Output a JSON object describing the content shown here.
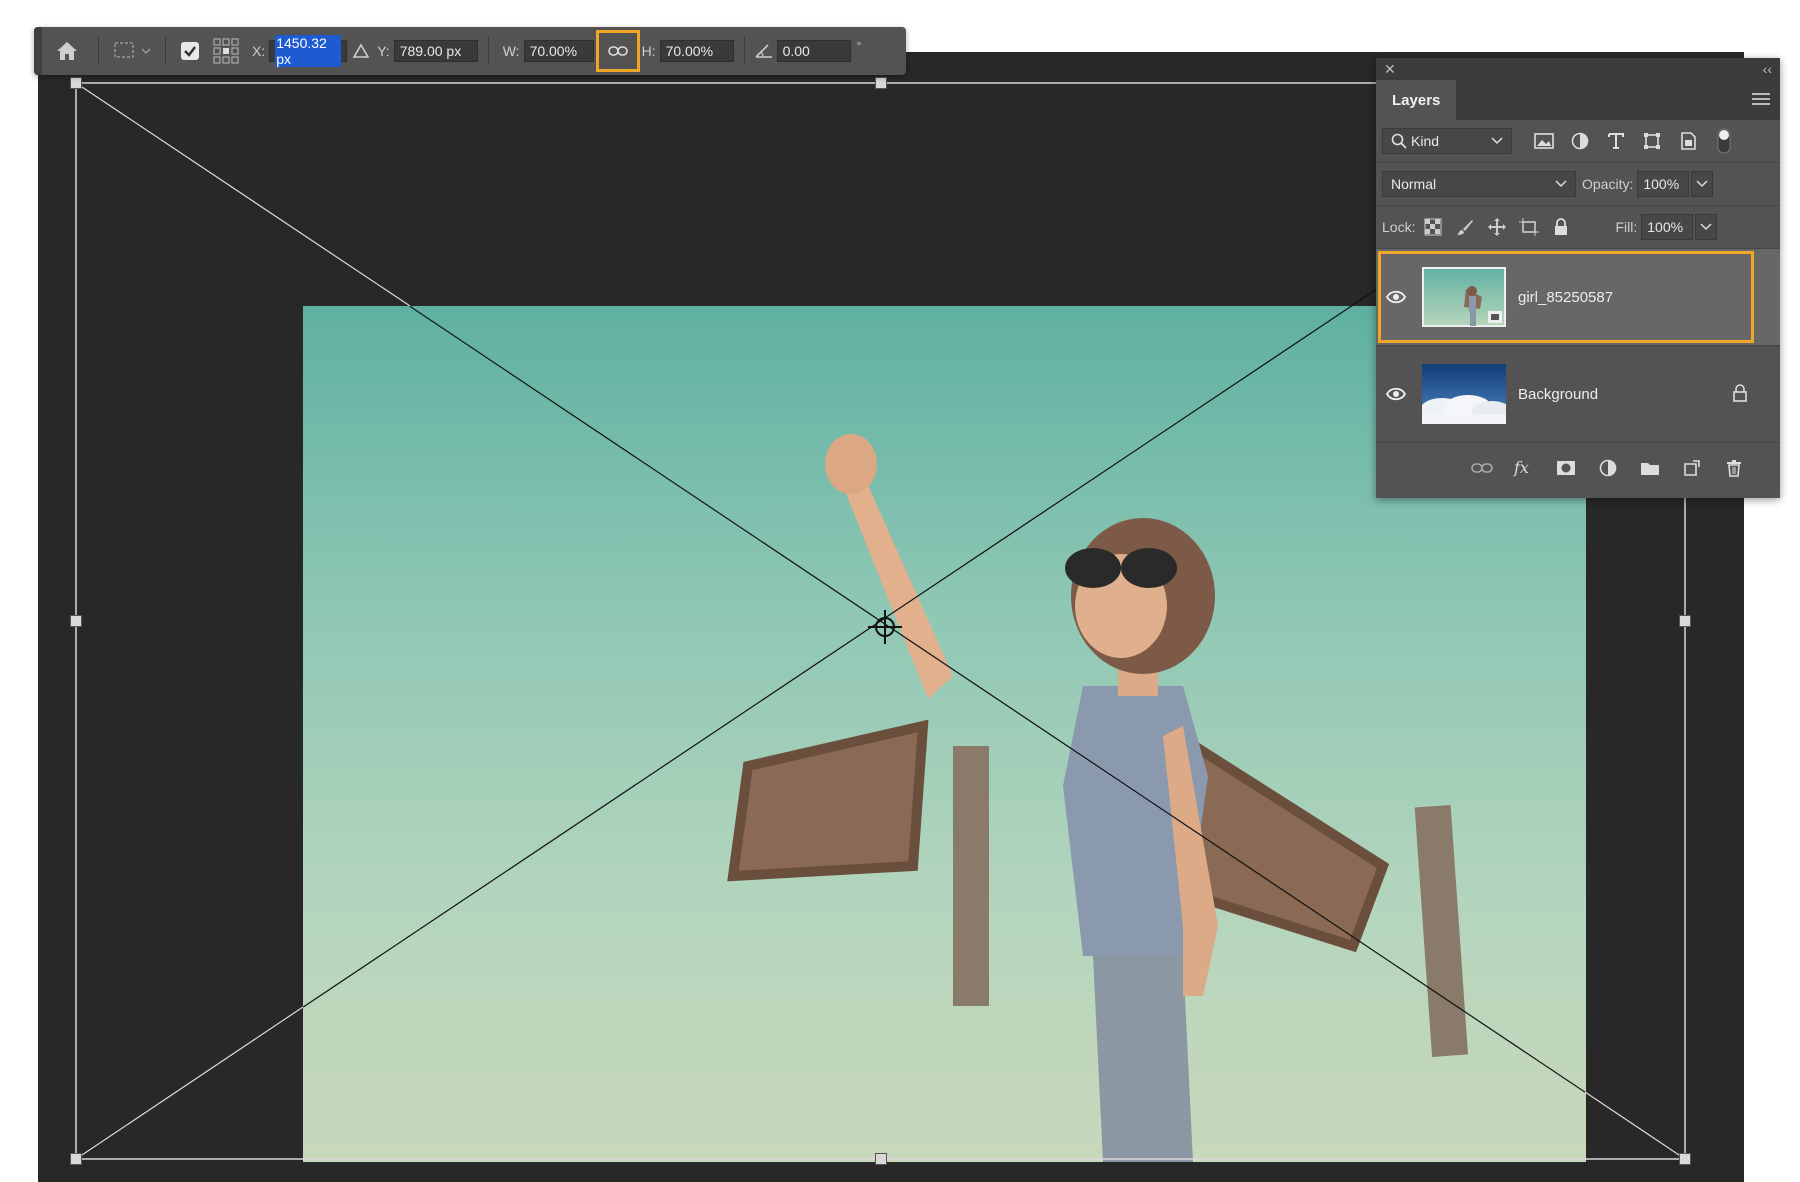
{
  "options_bar": {
    "x_label": "X:",
    "x_value": "1450.32 px",
    "y_label": "Y:",
    "y_value": "789.00 px",
    "w_label": "W:",
    "w_value": "70.00%",
    "h_label": "H:",
    "h_value": "70.00%",
    "angle_value": "0.00",
    "angle_unit": "°"
  },
  "layers_panel": {
    "close_glyph": "✕",
    "collapse_glyph": "‹‹",
    "tab_label": "Layers",
    "filter_label": "Kind",
    "blend_mode": "Normal",
    "opacity_label": "Opacity:",
    "opacity_value": "100%",
    "lock_label": "Lock:",
    "fill_label": "Fill:",
    "fill_value": "100%",
    "layers": [
      {
        "name": "girl_85250587",
        "selected": true,
        "visible": true
      },
      {
        "name": "Background",
        "selected": false,
        "visible": true,
        "locked": true
      }
    ]
  },
  "colors": {
    "highlight": "#f0a626",
    "panel_bg": "#535353",
    "canvas_bg": "#282828",
    "selection": "#1f5bd0"
  }
}
